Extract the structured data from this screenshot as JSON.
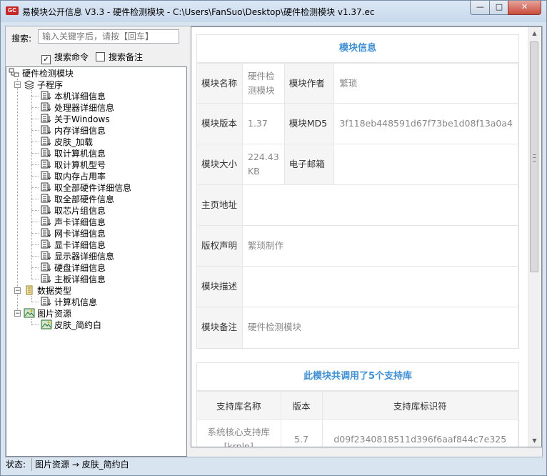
{
  "window": {
    "app_icon_text": "GC",
    "title": "易模块公开信息 V3.3 - 硬件检测模块 - C:\\Users\\FanSuo\\Desktop\\硬件检测模块 v1.37.ec",
    "minimize": "—",
    "maximize": "□",
    "close": "✕"
  },
  "search": {
    "label": "搜索:",
    "placeholder": "输入关键字后，请按【回车】",
    "search_commands_label": "搜索命令",
    "search_commands_checked": true,
    "search_notes_label": "搜索备注",
    "search_notes_checked": false
  },
  "tree": {
    "root": "硬件检测模块",
    "groups": [
      {
        "label": "子程序",
        "icon": "stack-icon",
        "items": [
          "本机详细信息",
          "处理器详细信息",
          "关于Windows",
          "内存详细信息",
          "皮肤_加载",
          "取计算机信息",
          "取计算机型号",
          "取内存占用率",
          "取全部硬件详细信息",
          "取全部硬件信息",
          "取芯片组信息",
          "声卡详细信息",
          "网卡详细信息",
          "显卡详细信息",
          "显示器详细信息",
          "硬盘详细信息",
          "主板详细信息"
        ]
      },
      {
        "label": "数据类型",
        "icon": "datatype-icon",
        "items": [
          "计算机信息"
        ]
      },
      {
        "label": "图片资源",
        "icon": "image-icon",
        "items": [
          "皮肤_简约白"
        ]
      }
    ]
  },
  "module_info": {
    "title": "模块信息",
    "labels": {
      "name": "模块名称",
      "author": "模块作者",
      "version": "模块版本",
      "md5": "模块MD5",
      "size": "模块大小",
      "email": "电子邮箱",
      "homepage": "主页地址",
      "copyright": "版权声明",
      "description": "模块描述",
      "note": "模块备注"
    },
    "values": {
      "name": "硬件检测模块",
      "author": "繁琐",
      "version": "1.37",
      "md5": "3f118eb448591d67f73be1d08f13a0a4",
      "size": "224.43 KB",
      "email": "",
      "homepage": "",
      "copyright": "繁琐制作",
      "description": "",
      "note": "硬件检测模块"
    }
  },
  "libraries": {
    "title": "此模块共调用了5个支持库",
    "columns": [
      "支持库名称",
      "版本",
      "支持库标识符"
    ],
    "rows": [
      [
        "系统核心支持库 [krnln]",
        "5.7",
        "d09f2340818511d396f6aaf844c7e325"
      ]
    ]
  },
  "status": {
    "label": "状态:",
    "value": "图片资源 → 皮肤_简约白"
  }
}
